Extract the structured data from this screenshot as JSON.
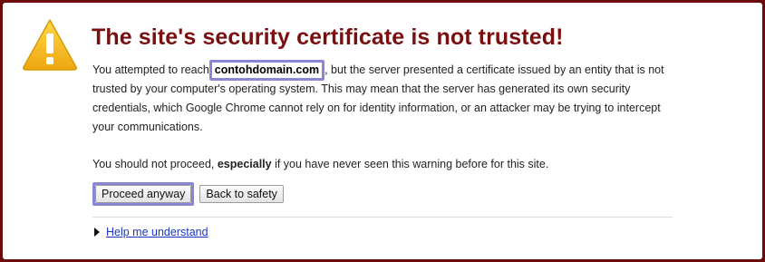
{
  "page": {
    "title": "The site's security certificate is not trusted!"
  },
  "message": {
    "intro_before": "You attempted to reach",
    "domain": "contohdomain.com",
    "intro_after": ", but the server presented a certificate issued by an entity that is not trusted by your computer's operating system. This may mean that the server has generated its own security credentials, which Google Chrome cannot rely on for identity information, or an attacker may be trying to intercept your communications.",
    "warn_before": "You should not proceed, ",
    "warn_emphasis": "especially",
    "warn_after": " if you have never seen this warning before for this site."
  },
  "buttons": {
    "proceed_label": "Proceed anyway",
    "back_label": "Back to safety"
  },
  "help": {
    "label": "Help me understand"
  },
  "icons": {
    "warning": "warning-icon",
    "expand": "expand-triangle-icon"
  },
  "colors": {
    "title": "#7a0f0f",
    "background": "#6b0b0b",
    "highlight": "#8a86d6",
    "link": "#1d37c4",
    "warning_icon": "#f2b81f"
  }
}
